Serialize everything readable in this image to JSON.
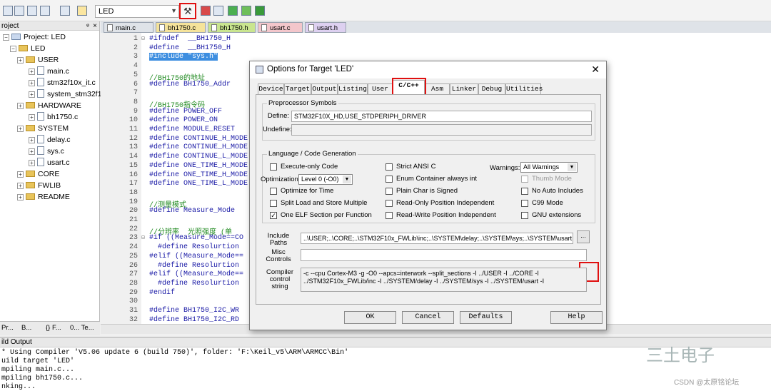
{
  "toolbar": {
    "target": "LED"
  },
  "project": {
    "header": "roject",
    "root": "Project: LED",
    "target": "LED",
    "items": [
      {
        "label": "USER",
        "kind": "folder"
      },
      {
        "label": "main.c",
        "kind": "file"
      },
      {
        "label": "stm32f10x_it.c",
        "kind": "file"
      },
      {
        "label": "system_stm32f1",
        "kind": "file"
      },
      {
        "label": "HARDWARE",
        "kind": "folder"
      },
      {
        "label": "bh1750.c",
        "kind": "file"
      },
      {
        "label": "SYSTEM",
        "kind": "folder"
      },
      {
        "label": "delay.c",
        "kind": "file"
      },
      {
        "label": "sys.c",
        "kind": "file"
      },
      {
        "label": "usart.c",
        "kind": "file"
      },
      {
        "label": "CORE",
        "kind": "folder"
      },
      {
        "label": "FWLIB",
        "kind": "folder"
      },
      {
        "label": "README",
        "kind": "folder"
      }
    ],
    "tabs": [
      "Pr...",
      "B...",
      "{} F...",
      "0... Te..."
    ]
  },
  "file_tabs": [
    {
      "label": "main.c",
      "color": "#dfe3e8"
    },
    {
      "label": "bh1750.c",
      "color": "#f5e39a"
    },
    {
      "label": "bh1750.h",
      "color": "#c9e58f"
    },
    {
      "label": "usart.c",
      "color": "#f3c6cb"
    },
    {
      "label": "usart.h",
      "color": "#ddd0f0"
    }
  ],
  "code": [
    {
      "n": "1",
      "t": "#ifndef  __BH1750_H"
    },
    {
      "n": "2",
      "t": "#define  __BH1750_H"
    },
    {
      "n": "3",
      "t": "#include \"sys.h\""
    },
    {
      "n": "4",
      "t": ""
    },
    {
      "n": "5",
      "t": "//BH1750的地址"
    },
    {
      "n": "6",
      "t": "#define BH1750_Addr"
    },
    {
      "n": "7",
      "t": ""
    },
    {
      "n": "8",
      "t": "//BH1750指令码"
    },
    {
      "n": "9",
      "t": "#define POWER_OFF"
    },
    {
      "n": "10",
      "t": "#define POWER_ON"
    },
    {
      "n": "11",
      "t": "#define MODULE_RESET"
    },
    {
      "n": "12",
      "t": "#define CONTINUE_H_MODE"
    },
    {
      "n": "13",
      "t": "#define CONTINUE_H_MODE"
    },
    {
      "n": "14",
      "t": "#define CONTINUE_L_MODE"
    },
    {
      "n": "15",
      "t": "#define ONE_TIME_H_MODE"
    },
    {
      "n": "16",
      "t": "#define ONE_TIME_H_MODE"
    },
    {
      "n": "17",
      "t": "#define ONE_TIME_L_MODE"
    },
    {
      "n": "18",
      "t": ""
    },
    {
      "n": "19",
      "t": "//测量模式"
    },
    {
      "n": "20",
      "t": "#define Measure_Mode"
    },
    {
      "n": "21",
      "t": ""
    },
    {
      "n": "22",
      "t": "//分辨率  光照强度 (单"
    },
    {
      "n": "23",
      "t": "#if ((Measure_Mode==CO"
    },
    {
      "n": "24",
      "t": "  #define Resolurtion"
    },
    {
      "n": "25",
      "t": "#elif ((Measure_Mode=="
    },
    {
      "n": "26",
      "t": "  #define Resolurtion"
    },
    {
      "n": "27",
      "t": "#elif ((Measure_Mode=="
    },
    {
      "n": "28",
      "t": "  #define Resolurtion"
    },
    {
      "n": "29",
      "t": "#endif"
    },
    {
      "n": "30",
      "t": ""
    },
    {
      "n": "31",
      "t": "#define BH1750_I2C_WR"
    },
    {
      "n": "32",
      "t": "#define BH1750_I2C_RD"
    }
  ],
  "build": {
    "header": "ild Output",
    "lines": [
      "* Using Compiler 'V5.06 update 6 (build 750)', folder: 'F:\\Keil_v5\\ARM\\ARMCC\\Bin'",
      "uild target 'LED'",
      "mpiling main.c...",
      "mpiling bh1750.c...",
      "nking..."
    ]
  },
  "watermark": {
    "big": "三土电子",
    "small": "CSDN @太原铭论坛"
  },
  "dialog": {
    "title": "Options for Target 'LED'",
    "tabs": [
      "Device",
      "Target",
      "Output",
      "Listing",
      "User",
      "C/C++",
      "Asm",
      "Linker",
      "Debug",
      "Utilities"
    ],
    "preproc": {
      "group": "Preprocessor Symbols",
      "define_label": "Define:",
      "define_value": "STM32F10X_HD,USE_STDPERIPH_DRIVER",
      "undefine_label": "Undefine:",
      "undefine_value": ""
    },
    "lang": {
      "group": "Language / Code Generation",
      "col1": [
        {
          "label": "Execute-only Code",
          "checked": false
        },
        {
          "label": "Optimize for Time",
          "checked": false
        },
        {
          "label": "Split Load and Store Multiple",
          "checked": false
        },
        {
          "label": "One ELF Section per Function",
          "checked": true
        }
      ],
      "optimization_label": "Optimization:",
      "optimization_value": "Level 0 (-O0)",
      "col2": [
        {
          "label": "Strict ANSI C",
          "checked": false
        },
        {
          "label": "Enum Container always int",
          "checked": false
        },
        {
          "label": "Plain Char is Signed",
          "checked": false
        },
        {
          "label": "Read-Only Position Independent",
          "checked": false
        },
        {
          "label": "Read-Write Position Independent",
          "checked": false
        }
      ],
      "warnings_label": "Warnings:",
      "warnings_value": "All Warnings",
      "col3": [
        {
          "label": "Thumb Mode",
          "checked": false,
          "disabled": true
        },
        {
          "label": "No Auto Includes",
          "checked": false
        },
        {
          "label": "C99 Mode",
          "checked": false
        },
        {
          "label": "GNU extensions",
          "checked": false
        }
      ]
    },
    "include_label_1": "Include",
    "include_label_2": "Paths",
    "include_value": "..\\USER;..\\CORE;..\\STM32F10x_FWLib\\inc;..\\SYSTEM\\delay;..\\SYSTEM\\sys;..\\SYSTEM\\usart;..\\",
    "misc_label_1": "Misc",
    "misc_label_2": "Controls",
    "misc_value": "",
    "compiler_label_1": "Compiler",
    "compiler_label_2": "control",
    "compiler_label_3": "string",
    "compiler_line1": "-c --cpu Cortex-M3 -g -O0 --apcs=interwork --split_sections -I ../USER -I ../CORE -I",
    "compiler_line2": "../STM32F10x_FWLib/inc -I ../SYSTEM/delay -I ../SYSTEM/sys -I ../SYSTEM/usart -I",
    "browse": "...",
    "buttons": {
      "ok": "OK",
      "cancel": "Cancel",
      "defaults": "Defaults",
      "help": "Help"
    }
  }
}
